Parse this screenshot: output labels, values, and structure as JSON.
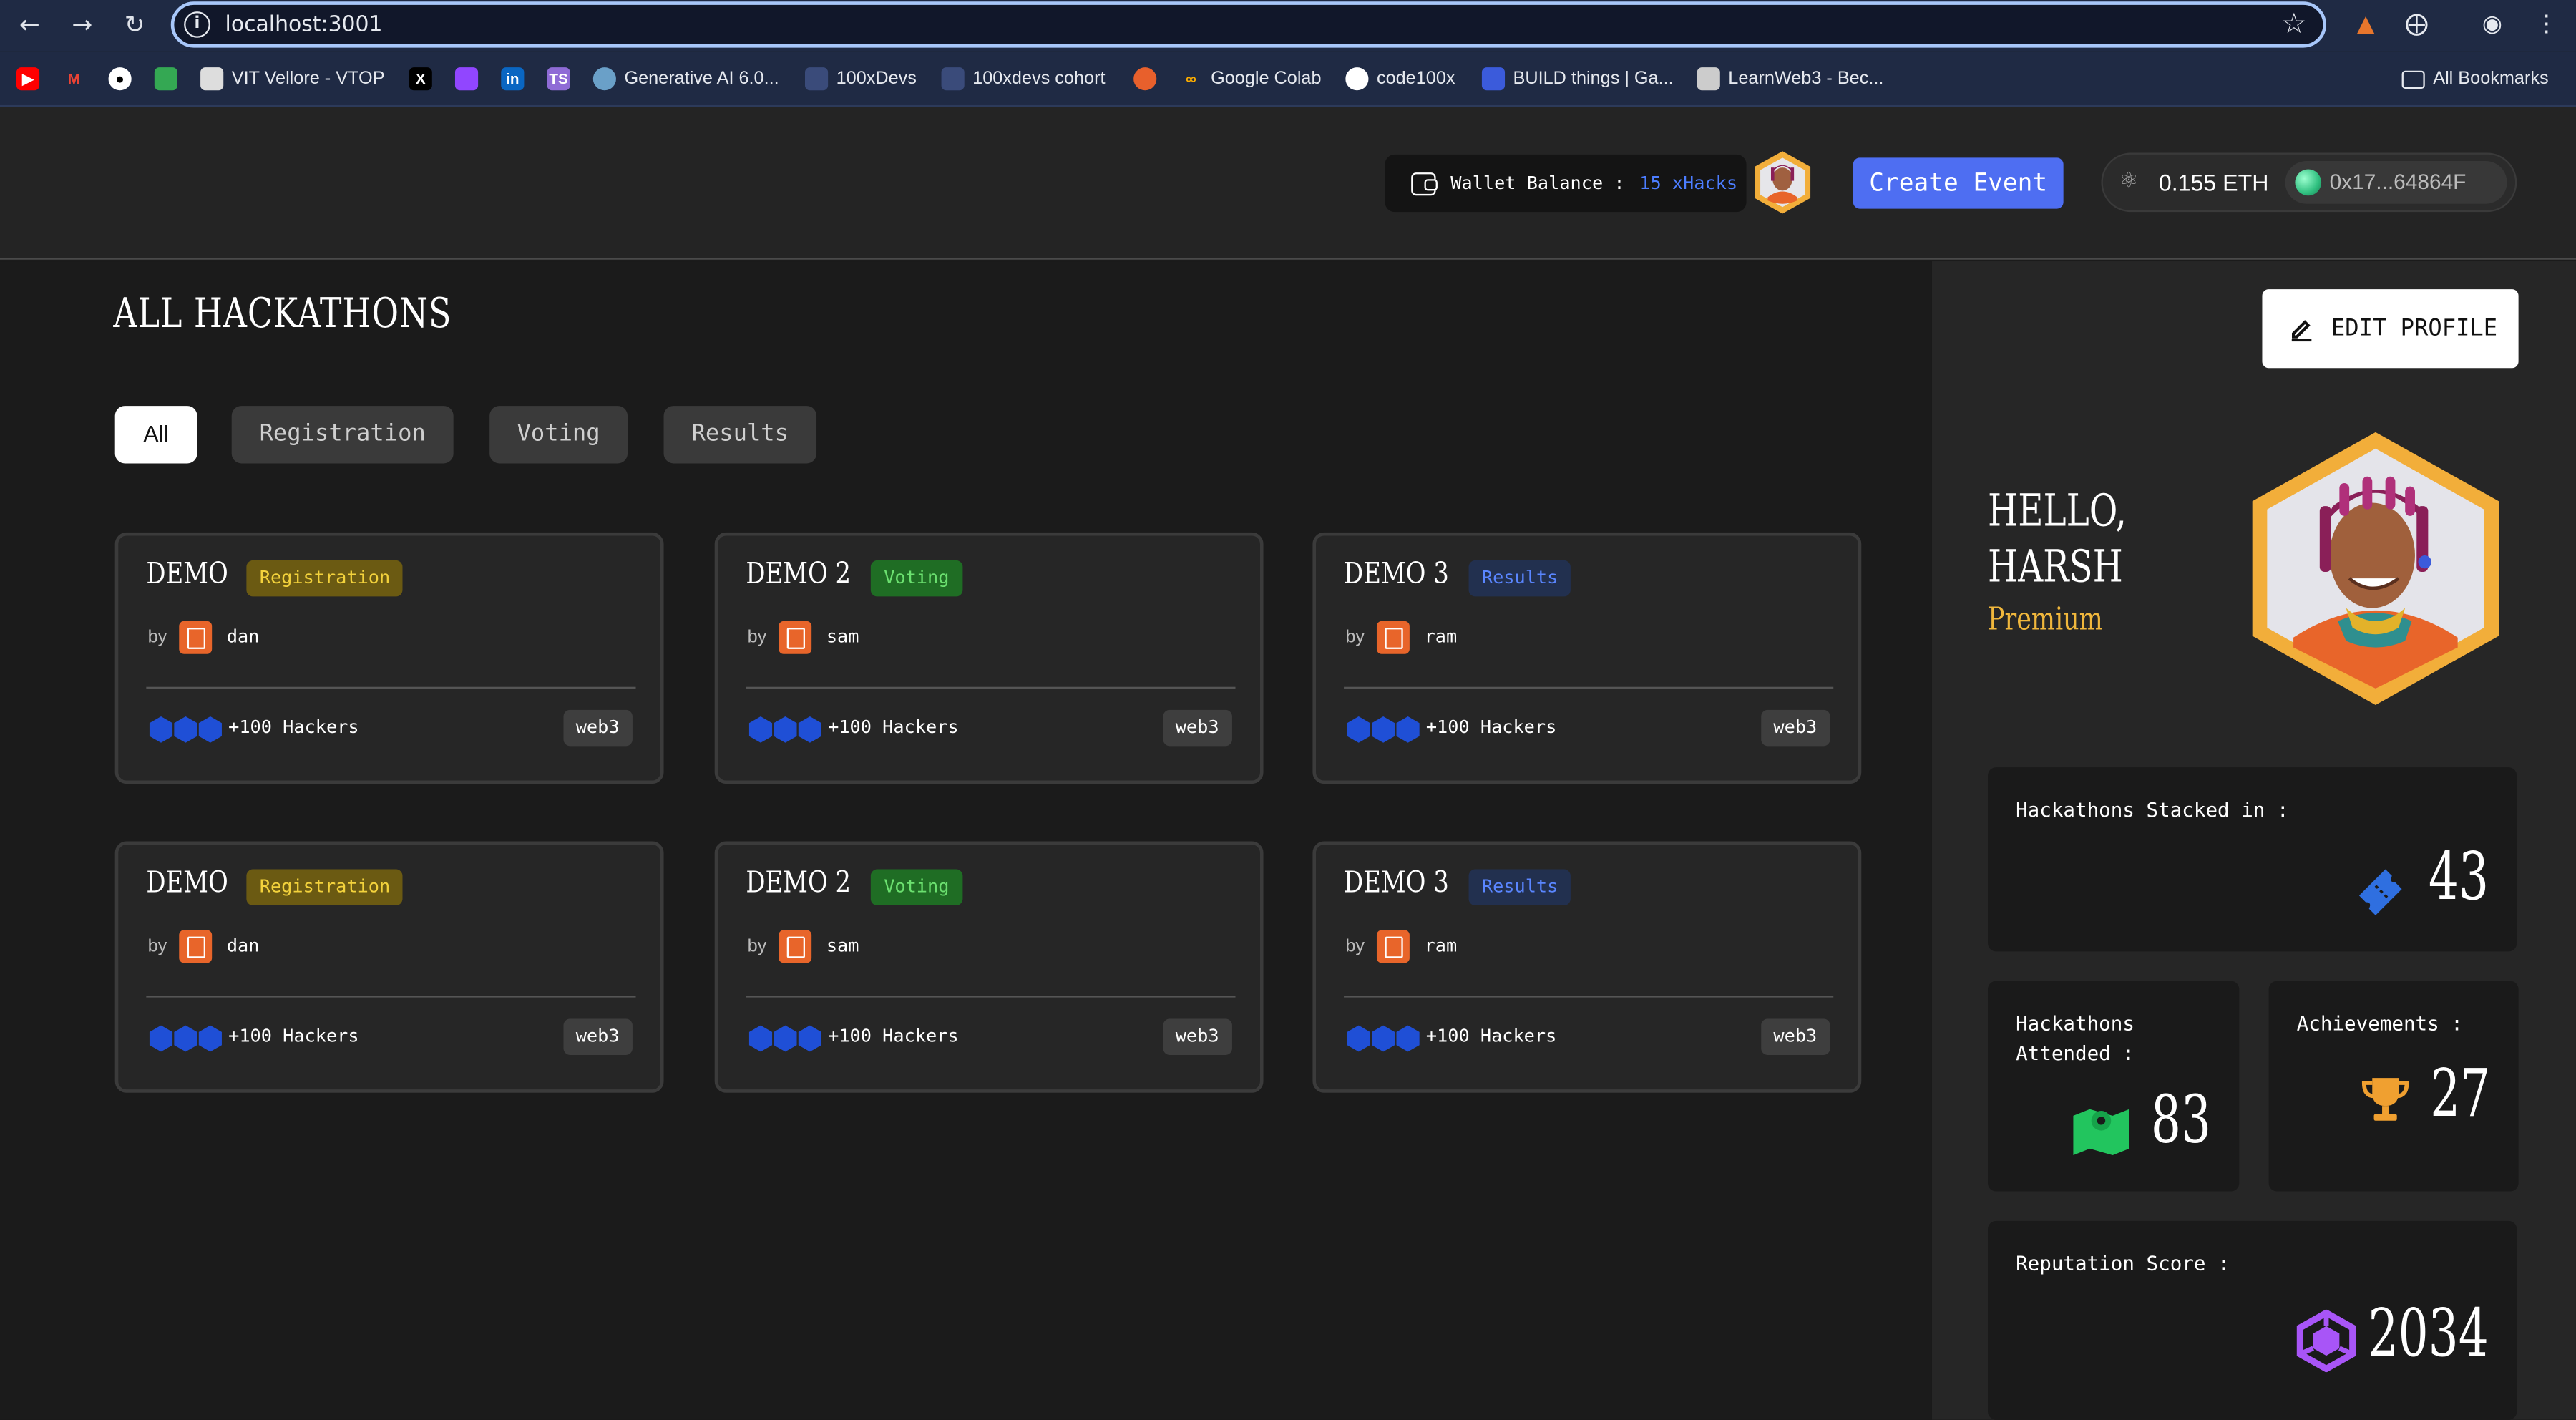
{
  "browser": {
    "url": "localhost:3001",
    "bookmarks": [
      {
        "label": "",
        "icon": "youtube-icon",
        "color": "#ff0000"
      },
      {
        "label": "",
        "icon": "gmail-icon",
        "color": "#ea4335"
      },
      {
        "label": "",
        "icon": "github-icon",
        "color": "#ffffff"
      },
      {
        "label": "",
        "icon": "classroom-icon",
        "color": "#34a853"
      },
      {
        "label": "VIT Vellore - VTOP",
        "icon": "vtop-icon",
        "color": "#dddddd"
      },
      {
        "label": "",
        "icon": "x-icon",
        "color": "#000000"
      },
      {
        "label": "",
        "icon": "twitch-icon",
        "color": "#9146ff"
      },
      {
        "label": "",
        "icon": "linkedin-icon",
        "color": "#0a66c2"
      },
      {
        "label": "",
        "icon": "ts-icon",
        "color": "#8f6bd6"
      },
      {
        "label": "Generative AI 6.0...",
        "icon": "genai-icon",
        "color": "#6aa0c8"
      },
      {
        "label": "100xDevs",
        "icon": "100xdevs-icon",
        "color": "#3a4b7a"
      },
      {
        "label": "100xdevs cohort",
        "icon": "100xdevs-icon",
        "color": "#3a4b7a"
      },
      {
        "label": "",
        "icon": "recall-icon",
        "color": "#e8602c"
      },
      {
        "label": "Google Colab",
        "icon": "colab-icon",
        "color": "#f9ab00"
      },
      {
        "label": "code100x",
        "icon": "github-icon",
        "color": "#ffffff"
      },
      {
        "label": "BUILD things | Ga...",
        "icon": "build-icon",
        "color": "#3b5bdb"
      },
      {
        "label": "LearnWeb3 - Bec...",
        "icon": "learnweb3-icon",
        "color": "#cccccc"
      }
    ],
    "all_bookmarks": "All Bookmarks"
  },
  "header": {
    "wallet_label": "Wallet Balance :",
    "wallet_amount": "15 xHacks",
    "create_event": "Create Event",
    "eth_balance": "0.155 ETH",
    "address": "0x17...64864F"
  },
  "main": {
    "title": "ALL HACKATHONS",
    "tabs": [
      "All",
      "Registration",
      "Voting",
      "Results"
    ],
    "active_tab": "All",
    "cards": [
      {
        "title": "DEMO",
        "status": "Registration",
        "by": "by",
        "organizer": "dan",
        "hackers": "+100 Hackers",
        "tag": "web3"
      },
      {
        "title": "DEMO 2",
        "status": "Voting",
        "by": "by",
        "organizer": "sam",
        "hackers": "+100 Hackers",
        "tag": "web3"
      },
      {
        "title": "DEMO 3",
        "status": "Results",
        "by": "by",
        "organizer": "ram",
        "hackers": "+100 Hackers",
        "tag": "web3"
      },
      {
        "title": "DEMO",
        "status": "Registration",
        "by": "by",
        "organizer": "dan",
        "hackers": "+100 Hackers",
        "tag": "web3"
      },
      {
        "title": "DEMO 2",
        "status": "Voting",
        "by": "by",
        "organizer": "sam",
        "hackers": "+100 Hackers",
        "tag": "web3"
      },
      {
        "title": "DEMO 3",
        "status": "Results",
        "by": "by",
        "organizer": "ram",
        "hackers": "+100 Hackers",
        "tag": "web3"
      }
    ]
  },
  "profile": {
    "edit_label": "EDIT PROFILE",
    "greeting": "HELLO,\nHARSH",
    "tier": "Premium",
    "stats": {
      "stacked": {
        "label": "Hackathons Stacked in :",
        "value": "43",
        "icon": "ticket-icon",
        "color": "#2f6fe0"
      },
      "attended": {
        "label": "Hackathons\nAttended :",
        "value": "83",
        "icon": "map-icon",
        "color": "#22c55e"
      },
      "achievements": {
        "label": "Achievements :",
        "value": "27",
        "icon": "trophy-icon",
        "color": "#f0a030"
      },
      "reputation": {
        "label": "Reputation Score :",
        "value": "2034",
        "icon": "reputation-icon",
        "color": "#a855f7"
      }
    }
  }
}
